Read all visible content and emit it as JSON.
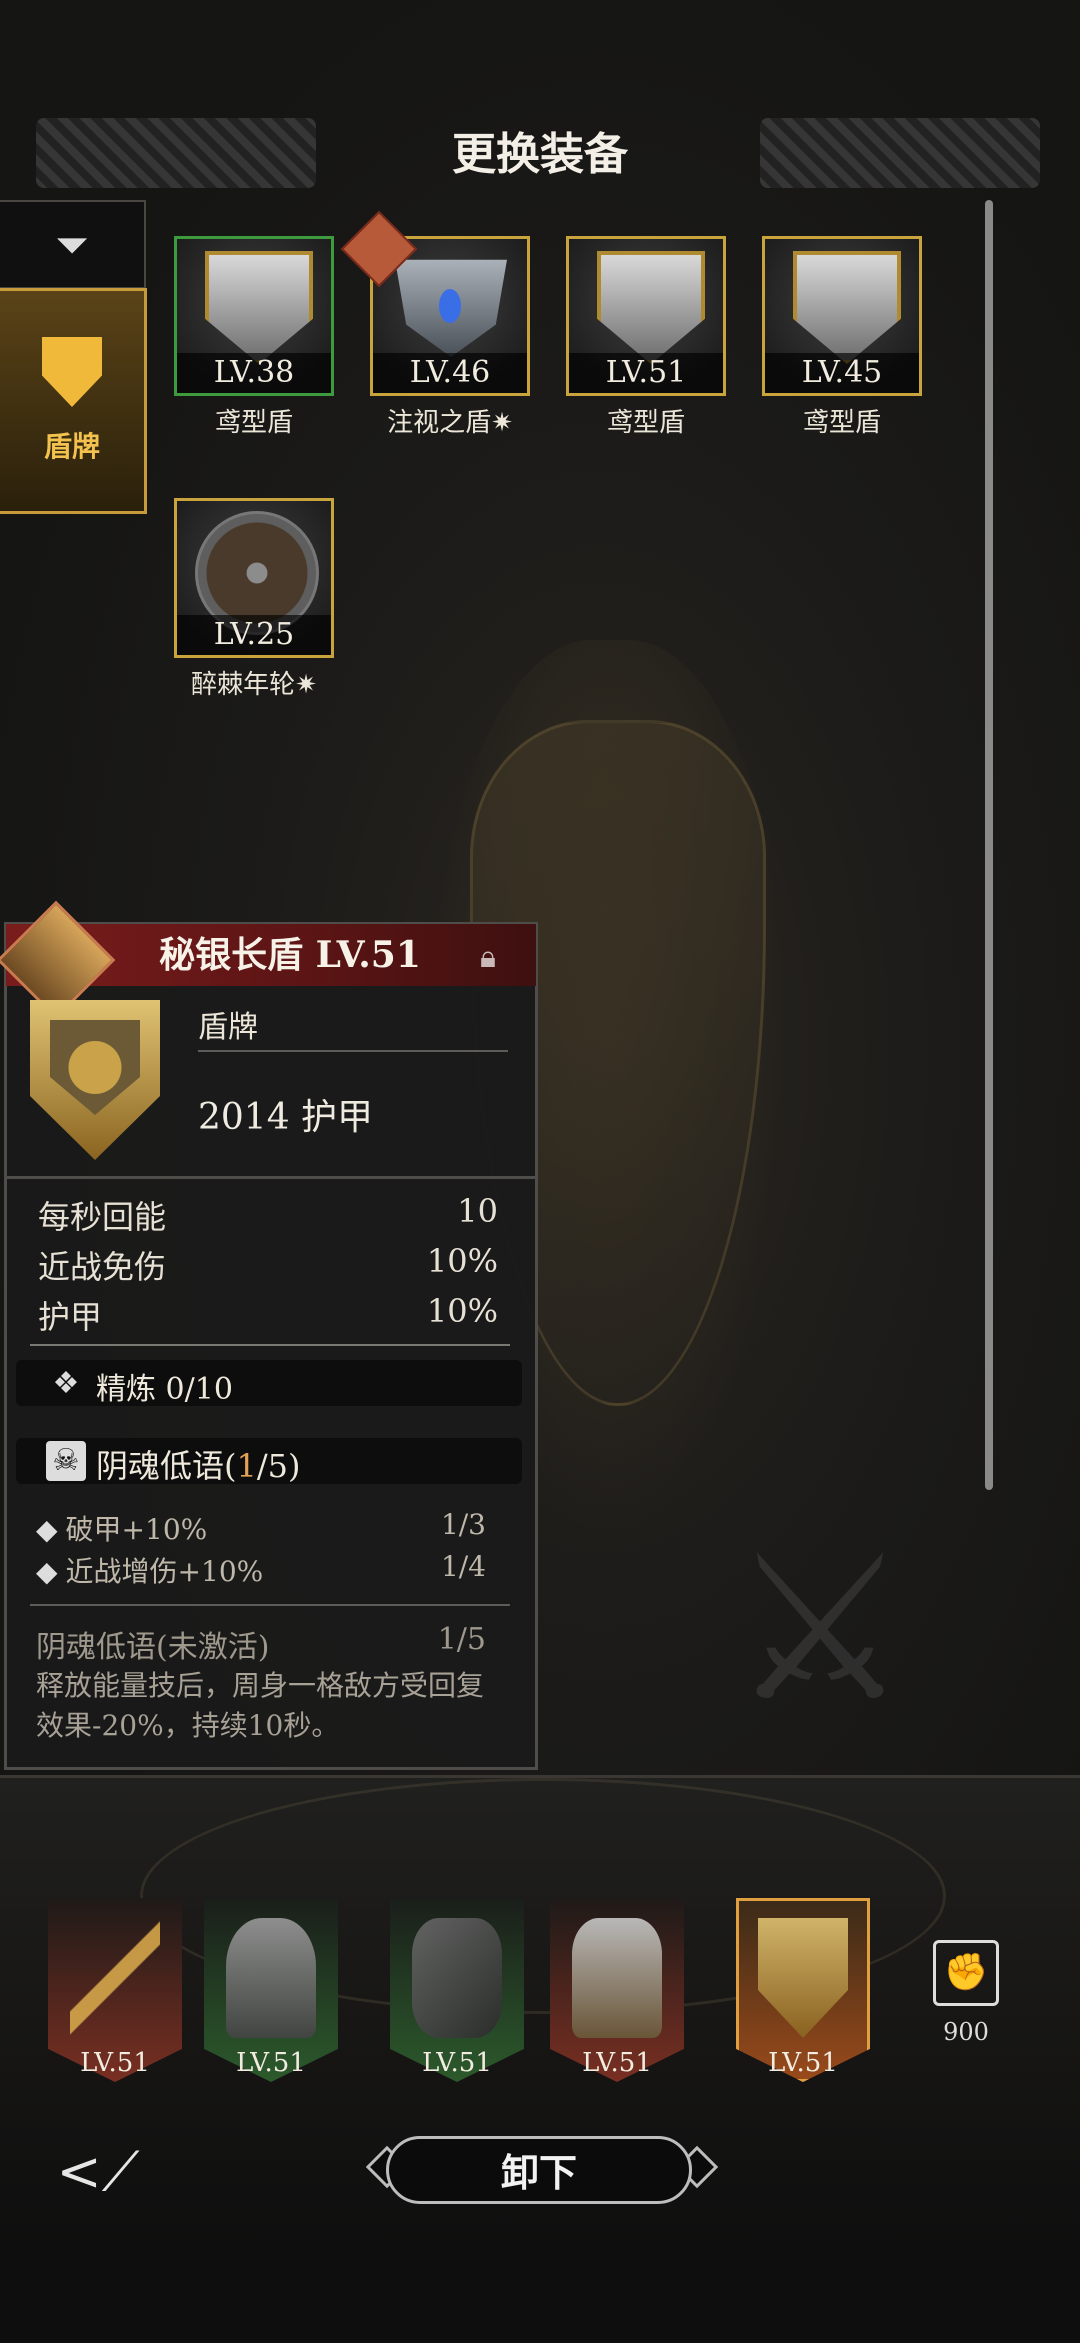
{
  "header": {
    "title": "更换装备"
  },
  "filter": {
    "icon": "filter-icon"
  },
  "category_tab": {
    "label": "盾牌",
    "icon": "shield-category-icon"
  },
  "inventory": [
    {
      "level": "LV.38",
      "name": "鸢型盾",
      "frame": "green"
    },
    {
      "level": "LV.46",
      "name": "注视之盾✷",
      "frame": "gold"
    },
    {
      "level": "LV.51",
      "name": "鸢型盾",
      "frame": "gold"
    },
    {
      "level": "LV.45",
      "name": "鸢型盾",
      "frame": "gold"
    },
    {
      "level": "LV.25",
      "name": "醉棘年轮✷",
      "frame": "gold"
    }
  ],
  "detail": {
    "title": "秘银长盾 LV.51",
    "category": "盾牌",
    "armor": "2014 护甲",
    "stats": [
      {
        "label": "每秒回能",
        "value": "10"
      },
      {
        "label": "近战免伤",
        "value": "10%"
      },
      {
        "label": "护甲",
        "value": "10%"
      }
    ],
    "refine": "精炼 0/10",
    "set": {
      "name": "阴魂低语(",
      "count": "1",
      "total": "/5)"
    },
    "set_bonuses": [
      {
        "label": "破甲+10%",
        "progress": "1/3"
      },
      {
        "label": "近战增伤+10%",
        "progress": "1/4"
      }
    ],
    "set_effect": {
      "label": "阴魂低语(未激活)",
      "progress": "1/5"
    },
    "description": "释放能量技后，周身一格敌方受回复效果-20%，持续10秒。"
  },
  "equipped": [
    {
      "level": "LV.51",
      "item": "sword-icon",
      "color": "#7a2f22"
    },
    {
      "level": "LV.51",
      "item": "gauntlet-icon",
      "color": "#2c5a2c"
    },
    {
      "level": "LV.51",
      "item": "bracer-icon",
      "color": "#2c5a2c"
    },
    {
      "level": "LV.51",
      "item": "armor-icon",
      "color": "#7a2f22"
    },
    {
      "level": "LV.51",
      "item": "shield-icon",
      "color": "#8a3a1a"
    }
  ],
  "power": {
    "value": "900",
    "icon": "fist-icon"
  },
  "footer": {
    "unload_label": "卸下",
    "back_icon": "back-arrow-icon"
  }
}
